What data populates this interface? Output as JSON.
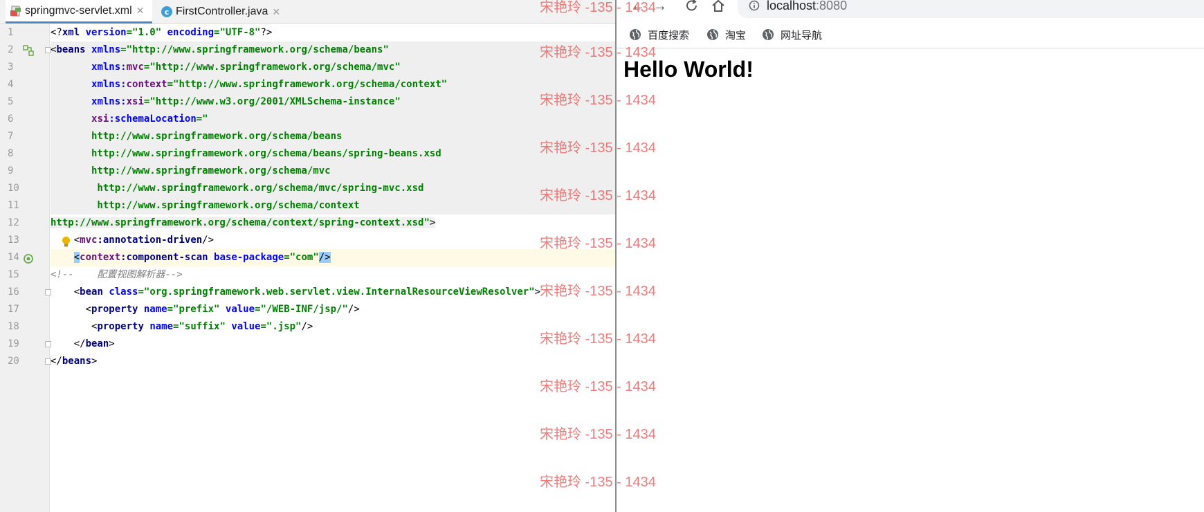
{
  "ide": {
    "tabs": [
      {
        "label": "springmvc-servlet.xml",
        "close": "✕"
      },
      {
        "label": "FirstController.java",
        "close": "✕"
      }
    ],
    "line_numbers": [
      "1",
      "2",
      "3",
      "4",
      "5",
      "6",
      "7",
      "8",
      "9",
      "10",
      "11",
      "12",
      "13",
      "14",
      "15",
      "16",
      "17",
      "18",
      "19",
      "20"
    ]
  },
  "browser": {
    "url_host": "localhost",
    "url_port": ":8080",
    "bookmarks": [
      "百度搜索",
      "淘宝",
      "网址导航"
    ],
    "heading": "Hello World!"
  },
  "watermark": "宋艳玲 -135 - 1434",
  "colors": {
    "tag": "#000080",
    "attribute": "#0000ff",
    "namespace": "#660e7a",
    "value": "#008000",
    "comment": "#808080",
    "selection": "#99ccff"
  },
  "icons": {
    "tab1": "xml-file-icon",
    "tab2": "java-class-icon",
    "gutter13": "lightbulb-icon",
    "gutter14": "spring-bean-icon",
    "browser_info": "info-icon",
    "bookmark": "globe-icon"
  }
}
